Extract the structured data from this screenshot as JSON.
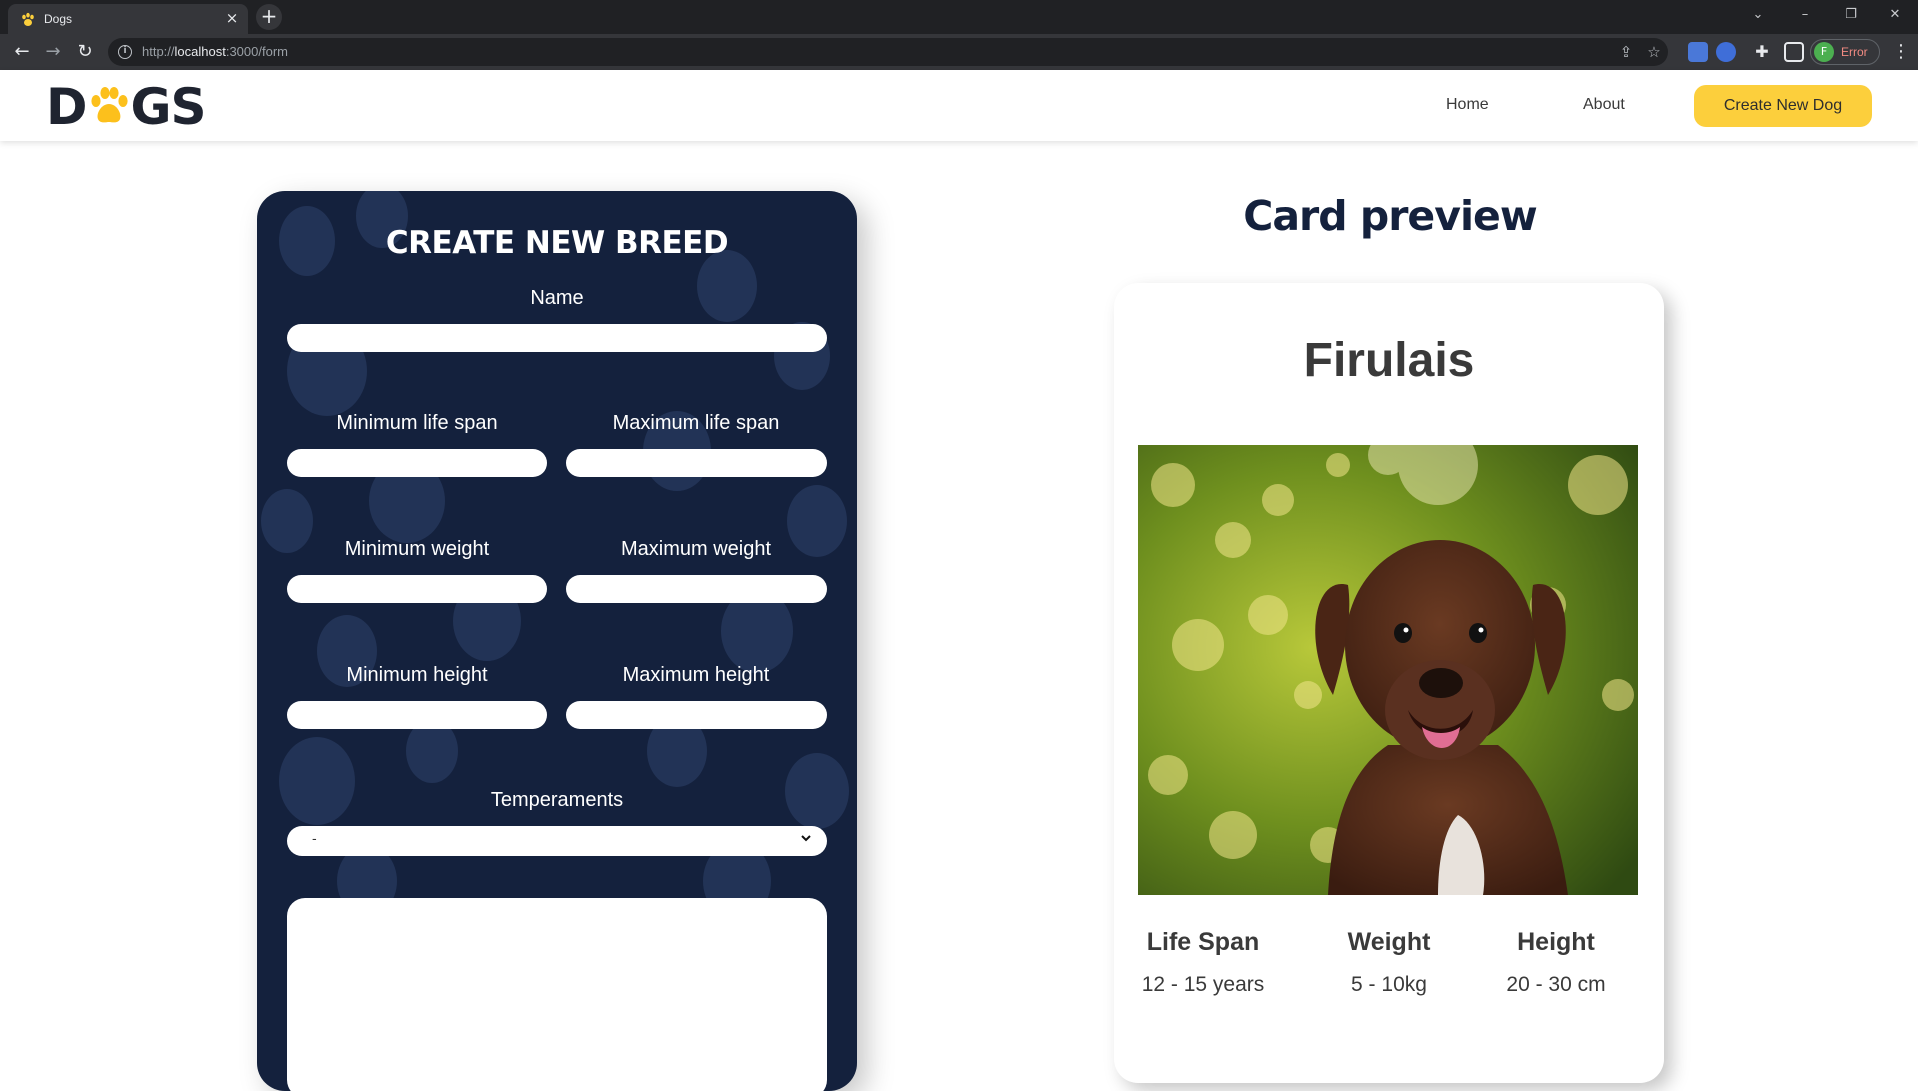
{
  "browser": {
    "tab_title": "Dogs",
    "tab_close": "×",
    "new_tab": "+",
    "url_scheme": "http://",
    "url_host": "localhost",
    "url_path": ":3000/form",
    "profile_initial": "F",
    "profile_label": "Error"
  },
  "header": {
    "logo_left": "D",
    "logo_right": "GS",
    "nav": [
      {
        "label": "Home"
      },
      {
        "label": "About"
      }
    ],
    "cta_label": "Create New Dog"
  },
  "form": {
    "title": "CREATE NEW BREED",
    "name_label": "Name",
    "min_life_label": "Minimum life span",
    "max_life_label": "Maximum life span",
    "min_weight_label": "Minimum weight",
    "max_weight_label": "Maximum weight",
    "min_height_label": "Minimum height",
    "max_height_label": "Maximum height",
    "temperaments_label": "Temperaments",
    "temperaments_value": "-"
  },
  "preview": {
    "heading": "Card preview",
    "name": "Firulais",
    "stats": [
      {
        "label": "Life Span",
        "value": "12 - 15 years"
      },
      {
        "label": "Weight",
        "value": "5 - 10kg"
      },
      {
        "label": "Height",
        "value": "20 - 30 cm"
      }
    ]
  },
  "colors": {
    "form_bg": "#14213d",
    "accent": "#fccf3c",
    "heading": "#14213d"
  }
}
